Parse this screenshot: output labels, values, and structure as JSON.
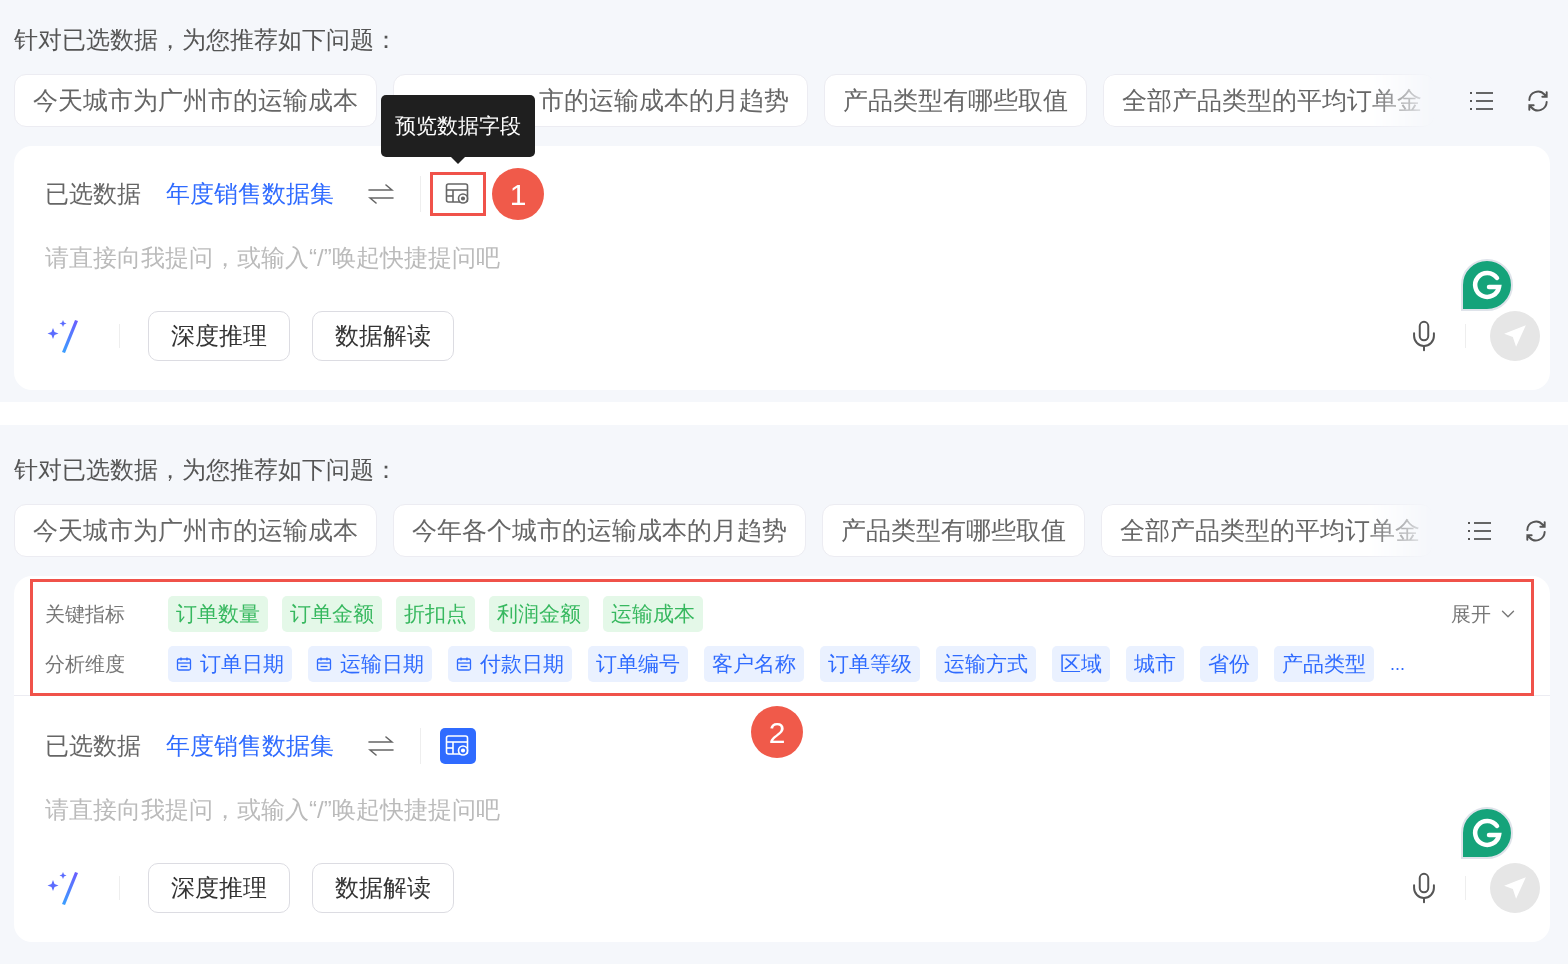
{
  "panels": [
    {
      "prompt_title": "针对已选数据，为您推荐如下问题：",
      "suggestions": [
        "今天城市为广州市的运输成本",
        {
          "text": "市的运输成本的月趋势",
          "covered": true
        },
        "产品类型有哪些取值",
        "全部产品类型的平均订单金"
      ],
      "tooltip": "预览数据字段",
      "selected_label": "已选数据",
      "dataset": "年度销售数据集",
      "preview_active": false,
      "callout": "1",
      "placeholder": "请直接向我提问，或输入“/”唤起快捷提问吧",
      "actions": [
        "深度推理",
        "数据解读"
      ]
    },
    {
      "prompt_title": "针对已选数据，为您推荐如下问题：",
      "suggestions": [
        "今天城市为广州市的运输成本",
        "今年各个城市的运输成本的月趋势",
        "产品类型有哪些取值",
        "全部产品类型的平均订单金"
      ],
      "fields": {
        "metrics_label": "关键指标",
        "metrics": [
          "订单数量",
          "订单金额",
          "折扣点",
          "利润金额",
          "运输成本"
        ],
        "expand": "展开",
        "dims_label": "分析维度",
        "dims": [
          {
            "name": "订单日期",
            "kind": "date"
          },
          {
            "name": "运输日期",
            "kind": "date"
          },
          {
            "name": "付款日期",
            "kind": "date"
          },
          {
            "name": "订单编号",
            "kind": "text"
          },
          {
            "name": "客户名称",
            "kind": "text"
          },
          {
            "name": "订单等级",
            "kind": "text"
          },
          {
            "name": "运输方式",
            "kind": "text"
          },
          {
            "name": "区域",
            "kind": "text"
          },
          {
            "name": "城市",
            "kind": "text"
          },
          {
            "name": "省份",
            "kind": "text"
          },
          {
            "name": "产品类型",
            "kind": "text"
          }
        ],
        "more": "..."
      },
      "selected_label": "已选数据",
      "dataset": "年度销售数据集",
      "preview_active": true,
      "callout": "2",
      "placeholder": "请直接向我提问，或输入“/”唤起快捷提问吧",
      "actions": [
        "深度推理",
        "数据解读"
      ]
    }
  ]
}
